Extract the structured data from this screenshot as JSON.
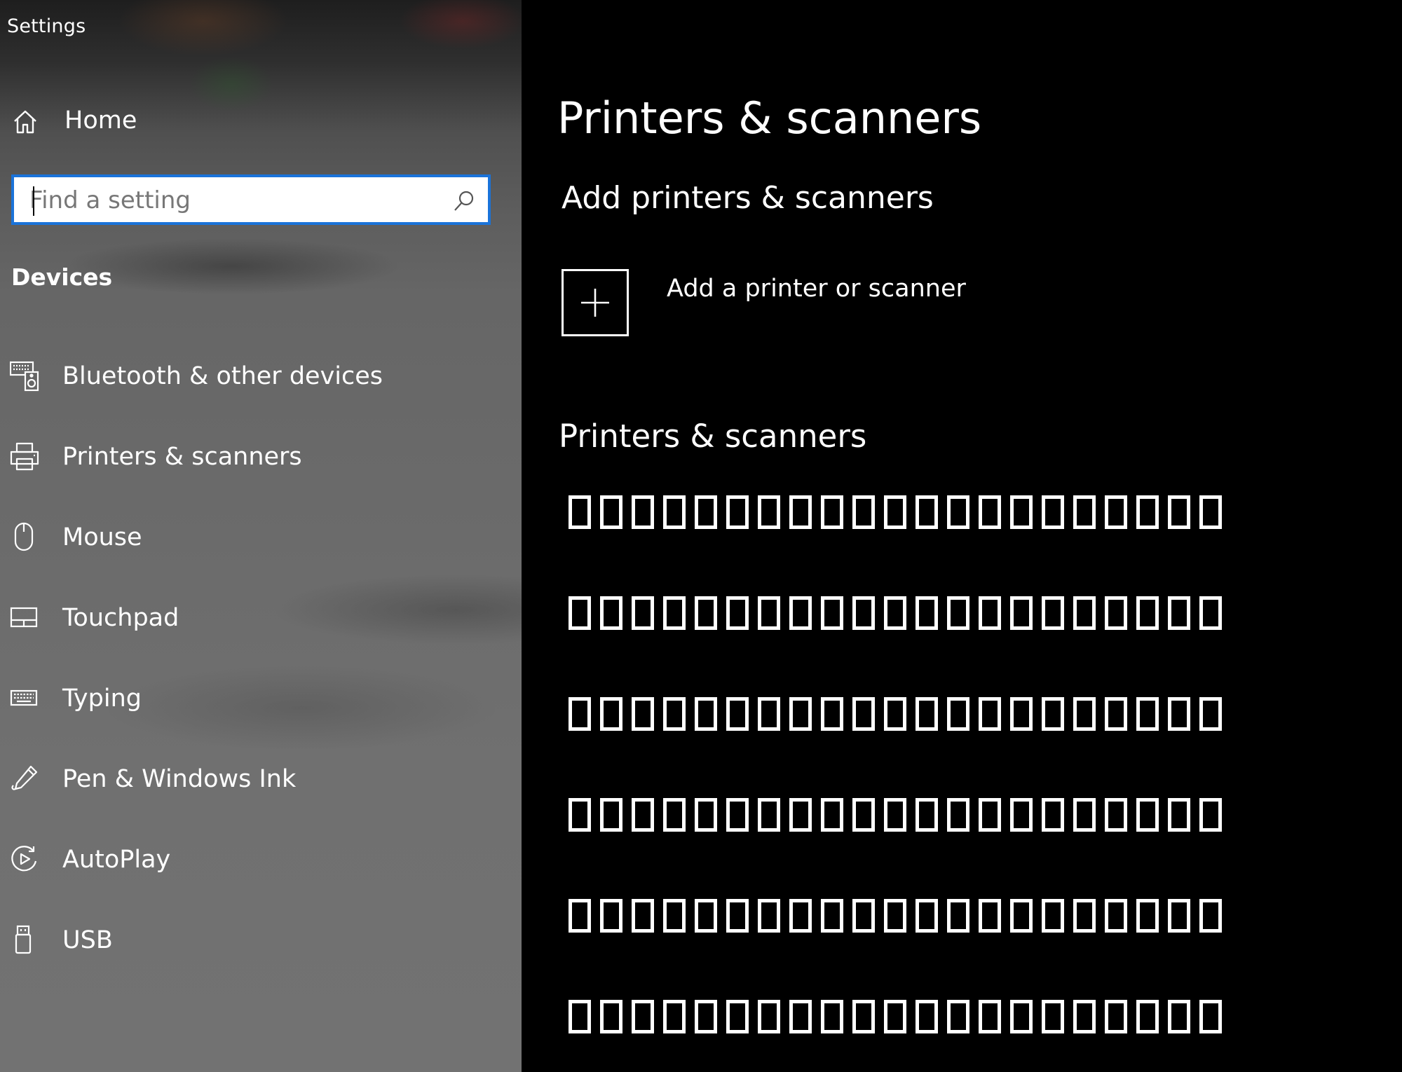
{
  "window": {
    "title": "Settings"
  },
  "nav": {
    "home_label": "Home",
    "search": {
      "placeholder": "Find a setting",
      "value": ""
    },
    "section_heading": "Devices",
    "items": [
      {
        "label": "Bluetooth & other devices",
        "icon": "bluetooth-devices-icon"
      },
      {
        "label": "Printers & scanners",
        "icon": "printer-icon"
      },
      {
        "label": "Mouse",
        "icon": "mouse-icon"
      },
      {
        "label": "Touchpad",
        "icon": "touchpad-icon"
      },
      {
        "label": "Typing",
        "icon": "keyboard-icon"
      },
      {
        "label": "Pen & Windows Ink",
        "icon": "pen-icon"
      },
      {
        "label": "AutoPlay",
        "icon": "autoplay-icon"
      },
      {
        "label": "USB",
        "icon": "usb-icon"
      }
    ]
  },
  "main": {
    "page_title": "Printers & scanners",
    "add_section_heading": "Add printers & scanners",
    "add_button_label": "Add a printer or scanner",
    "list_heading": "Printers & scanners",
    "device_rows": [
      "□□□□□□□□□□□□□□□□□□□□□",
      "□□□□□□□□□□□□□□□□□□□□□",
      "□□□□□□□□□□□□□□□□□□□□□",
      "□□□□□□□□□□□□□□□□□□□□□",
      "□□□□□□□□□□□□□□□□□□□□□",
      "□□□□□□□□□□□□□□□□□□□□□"
    ]
  },
  "colors": {
    "accent": "#1a73d9",
    "content_background": "#000000",
    "text": "#ffffff"
  }
}
